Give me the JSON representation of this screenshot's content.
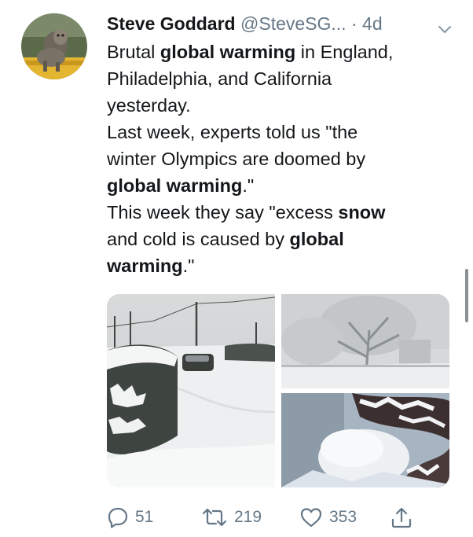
{
  "tweet": {
    "author": {
      "name": "Steve Goddard",
      "handle": "@SteveSG...",
      "separator": "·",
      "time": "4d"
    },
    "lines": [
      [
        {
          "t": "Brutal ",
          "b": false
        },
        {
          "t": "global warming",
          "b": true
        },
        {
          "t": " in England,",
          "b": false
        }
      ],
      [
        {
          "t": "Philadelphia, and California",
          "b": false
        }
      ],
      [
        {
          "t": "yesterday.",
          "b": false
        }
      ],
      [
        {
          "t": "Last week, experts told us \"the",
          "b": false
        }
      ],
      [
        {
          "t": "winter Olympics are doomed by",
          "b": false
        }
      ],
      [
        {
          "t": "global warming",
          "b": true
        },
        {
          "t": ".\"",
          "b": false
        }
      ],
      [
        {
          "t": "This week they say \"excess ",
          "b": false
        },
        {
          "t": "snow",
          "b": true
        }
      ],
      [
        {
          "t": "and cold is caused by ",
          "b": false
        },
        {
          "t": "global",
          "b": true
        }
      ],
      [
        {
          "t": "warming",
          "b": true
        },
        {
          "t": ".\"",
          "b": false
        }
      ]
    ],
    "stats": {
      "replies": "51",
      "retweets": "219",
      "likes": "353"
    }
  },
  "icons": {
    "menu": "chevron-down-icon",
    "reply": "reply-icon",
    "retweet": "retweet-icon",
    "like": "heart-icon",
    "share": "share-icon"
  },
  "colors": {
    "text": "#14171a",
    "secondary": "#657786",
    "background": "#ffffff"
  }
}
